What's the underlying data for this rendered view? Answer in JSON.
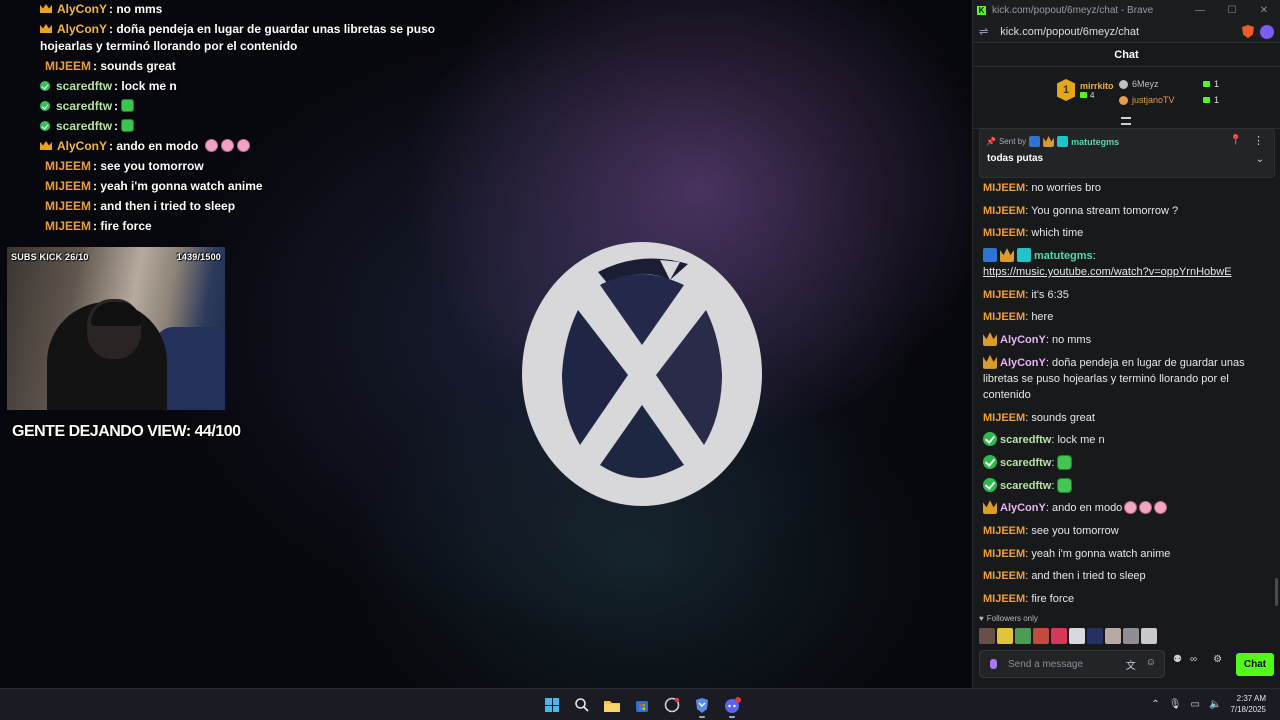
{
  "overlay_chat": [
    {
      "badge": "crown",
      "user": "AlyConY",
      "user_color": "#f6b73c",
      "text": ": no mms"
    },
    {
      "badge": "crown",
      "user": "AlyConY",
      "user_color": "#f6b73c",
      "text": ": doña pendeja en lugar de guardar unas libretas se puso hojearlas y terminó llorando por el contenido"
    },
    {
      "badge": "none",
      "user": "MIJEEM",
      "user_color": "#ef9f3a",
      "text": ": sounds great"
    },
    {
      "badge": "verified",
      "user": "scaredftw",
      "user_color": "#b8e1a6",
      "text": ": lock me n"
    },
    {
      "badge": "verified",
      "user": "scaredftw",
      "user_color": "#b8e1a6",
      "text": ": ",
      "emote": "green-emote"
    },
    {
      "badge": "verified",
      "user": "scaredftw",
      "user_color": "#b8e1a6",
      "text": ": ",
      "emote": "green-emote"
    },
    {
      "badge": "crown",
      "user": "AlyConY",
      "user_color": "#f6b73c",
      "text": ": ando en modo ",
      "emote": "pig-emote-x3"
    },
    {
      "badge": "none",
      "user": "MIJEEM",
      "user_color": "#ef9f3a",
      "text": ": see you tomorrow"
    },
    {
      "badge": "none",
      "user": "MIJEEM",
      "user_color": "#ef9f3a",
      "text": ": yeah i'm gonna watch anime"
    },
    {
      "badge": "none",
      "user": "MIJEEM",
      "user_color": "#ef9f3a",
      "text": ": and then i tried to sleep"
    },
    {
      "badge": "none",
      "user": "MIJEEM",
      "user_color": "#ef9f3a",
      "text": ": fire force"
    }
  ],
  "webcam": {
    "subs_text": "SUBS KICK 26/10",
    "goal_text": "1439/1500",
    "view_counter": "GENTE DEJANDO VIEW: 44/100"
  },
  "browser": {
    "title": "kick.com/popout/6meyz/chat - Brave",
    "url": "kick.com/popout/6meyz/chat",
    "minimize_icon": "minimize-icon",
    "maximize_icon": "maximize-icon",
    "close_icon": "close-icon"
  },
  "chat": {
    "header": "Chat",
    "leaderboard": {
      "first": {
        "rank": "1",
        "name": "mirrkito",
        "count": "4"
      },
      "others": [
        {
          "name": "6Meyz",
          "count": "1",
          "color": "#bfc0c4"
        },
        {
          "name": "justjanoTV",
          "count": "1",
          "color": "#e99a4a"
        }
      ]
    },
    "pinned": {
      "sent_by": "Sent by",
      "user": "matutegms",
      "text": "todas putas"
    },
    "messages": [
      {
        "user": "MIJEEM",
        "color": "#ef9f3a",
        "badges": [],
        "text": "no worries bro"
      },
      {
        "user": "MIJEEM",
        "color": "#ef9f3a",
        "badges": [],
        "text": "You gonna stream tomorrow ?"
      },
      {
        "user": "MIJEEM",
        "color": "#ef9f3a",
        "badges": [],
        "text": "which time"
      },
      {
        "user": "matutegms",
        "color": "#53d8a9",
        "badges": [
          "blue",
          "crown",
          "teal"
        ],
        "text": "",
        "link": "https://music.youtube.com/watch?v=oppYrnHobwE"
      },
      {
        "user": "MIJEEM",
        "color": "#ef9f3a",
        "badges": [],
        "text": "it's 6:35"
      },
      {
        "user": "MIJEEM",
        "color": "#ef9f3a",
        "badges": [],
        "text": "here"
      },
      {
        "user": "AlyConY",
        "color": "#e8b3f0",
        "badges": [
          "crown"
        ],
        "text": "no mms"
      },
      {
        "user": "AlyConY",
        "color": "#e8b3f0",
        "badges": [
          "crown"
        ],
        "text": "doña pendeja en lugar de guardar unas libretas se puso hojearlas y terminó llorando por el contenido"
      },
      {
        "user": "MIJEEM",
        "color": "#ef9f3a",
        "badges": [],
        "text": "sounds great"
      },
      {
        "user": "scaredftw",
        "color": "#b8e1a6",
        "badges": [
          "verified"
        ],
        "text": "lock me n"
      },
      {
        "user": "scaredftw",
        "color": "#b8e1a6",
        "badges": [
          "verified"
        ],
        "text": "",
        "emote": "green"
      },
      {
        "user": "scaredftw",
        "color": "#b8e1a6",
        "badges": [
          "verified"
        ],
        "text": "",
        "emote": "green"
      },
      {
        "user": "AlyConY",
        "color": "#e8b3f0",
        "badges": [
          "crown"
        ],
        "text": "ando en modo",
        "emote": "pig3"
      },
      {
        "user": "MIJEEM",
        "color": "#ef9f3a",
        "badges": [],
        "text": "see you tomorrow"
      },
      {
        "user": "MIJEEM",
        "color": "#ef9f3a",
        "badges": [],
        "text": "yeah i'm gonna watch anime"
      },
      {
        "user": "MIJEEM",
        "color": "#ef9f3a",
        "badges": [],
        "text": "and then i tried to sleep"
      },
      {
        "user": "MIJEEM",
        "color": "#ef9f3a",
        "badges": [],
        "text": "fire force"
      }
    ],
    "followers_only": "Followers only",
    "input_placeholder": "Send a message",
    "send_button": "Chat",
    "accent": "#53fc18"
  },
  "taskbar": {
    "time": "2:37 AM",
    "date": "7/18/2025",
    "icons": [
      "windows-start-icon",
      "search-icon",
      "file-explorer-icon",
      "store-icon",
      "browser-icon",
      "brave-icon",
      "discord-icon"
    ]
  }
}
